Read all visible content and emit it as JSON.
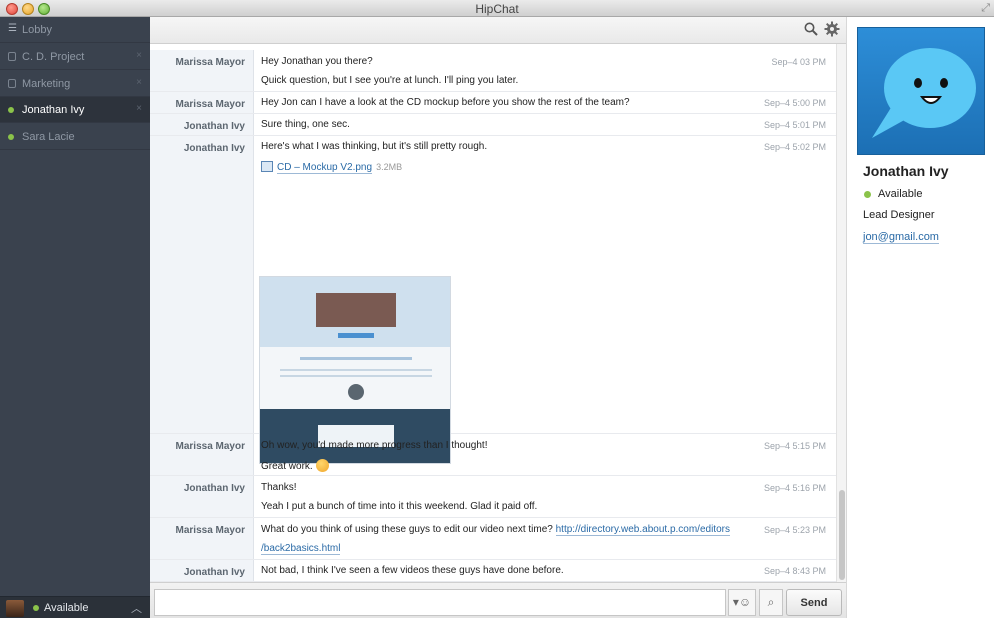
{
  "window": {
    "title": "HipChat"
  },
  "sidebar": {
    "rooms": [
      {
        "label": "Lobby",
        "icon": "list-icon"
      },
      {
        "label": "C. D. Project",
        "icon": "lock-icon"
      },
      {
        "label": "Marketing",
        "icon": "lock-icon"
      },
      {
        "label": "Jonathan Ivy",
        "icon": "status-dot-icon",
        "active": true
      },
      {
        "label": "Sara Lacie",
        "icon": "status-dot-icon"
      }
    ],
    "close_glyph": "×",
    "presence": {
      "label": "Available"
    }
  },
  "messages": [
    {
      "sender": "Marissa Mayor",
      "lines": [
        "Hey Jonathan you there?",
        "Quick question, but I see you're at lunch. I'll ping you later."
      ],
      "time": "Sep–4 03 PM"
    },
    {
      "sender": "Marissa Mayor",
      "lines": [
        "Hey Jon can I have a look at the CD mockup before you show the rest of the team?"
      ],
      "time": "Sep–4 5:00 PM"
    },
    {
      "sender": "Jonathan Ivy",
      "lines": [
        "Sure thing, one sec."
      ],
      "time": "Sep–4 5:01 PM"
    },
    {
      "sender": "Jonathan Ivy",
      "lines": [
        "Here's what I was thinking, but it's still pretty rough."
      ],
      "time": "Sep–4 5:02 PM",
      "file": {
        "name": "CD – Mockup V2.png",
        "size": "3.2MB"
      }
    },
    {
      "sender": "Marissa Mayor",
      "lines": [
        "Oh wow, you'd made more progress than I thought!",
        "Great work."
      ],
      "time": "Sep–4 5:15 PM"
    },
    {
      "sender": "Jonathan Ivy",
      "lines": [
        "Thanks!",
        "Yeah I put a bunch of time into it this weekend. Glad it paid off."
      ],
      "time": "Sep–4 5:16 PM"
    },
    {
      "sender": "Marissa Mayor",
      "lines": [
        "What do you think of using these guys to edit our video next time?"
      ],
      "link1": "http://directory.web.about.p.com/editors",
      "link2": "/back2basics.html",
      "time": "Sep–4 5:23 PM"
    },
    {
      "sender": "Jonathan Ivy",
      "lines": [
        "Not bad, I think I've seen a few videos these guys have done before."
      ],
      "time": "Sep–4 8:43 PM"
    }
  ],
  "composer": {
    "send_label": "Send"
  },
  "profile": {
    "name": "Jonathan Ivy",
    "status": "Available",
    "title": "Lead Designer",
    "email": "jon@gmail.com"
  },
  "colors": {
    "sidebar_bg": "#3a424e",
    "active_room_bg": "#2d333c",
    "available_green": "#8bc34a",
    "link_blue": "#2a6aa6",
    "avatar_blue": "#2d8ed8"
  }
}
